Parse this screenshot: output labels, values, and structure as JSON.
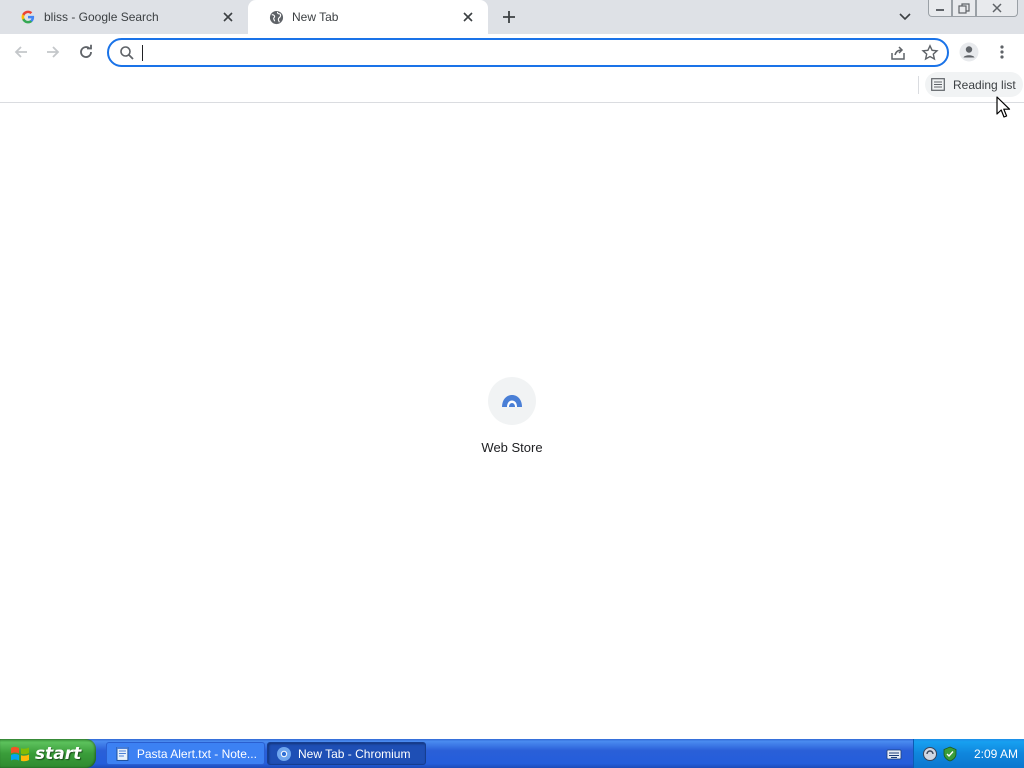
{
  "tabs": [
    {
      "title": "bliss - Google Search",
      "favicon": "google-g-icon",
      "active": false
    },
    {
      "title": "New Tab",
      "favicon": "globe-icon",
      "active": true
    }
  ],
  "toolbar": {
    "omnibox_value": "",
    "omnibox_placeholder": ""
  },
  "bookmarks_bar": {
    "reading_list_label": "Reading list"
  },
  "shortcuts": [
    {
      "label": "Web Store",
      "icon": "web-store-icon"
    }
  ],
  "taskbar": {
    "start_label": "start",
    "tasks": [
      {
        "label": "Pasta Alert.txt - Note...",
        "icon": "notepad-icon",
        "active": false
      },
      {
        "label": "New Tab - Chromium",
        "icon": "chromium-icon",
        "active": true
      }
    ],
    "clock": "2:09 AM"
  },
  "colors": {
    "accent": "#1a73e8",
    "tabstrip": "#dee1e6",
    "taskbar": "#245edb",
    "start_green": "#3a9d3a"
  }
}
